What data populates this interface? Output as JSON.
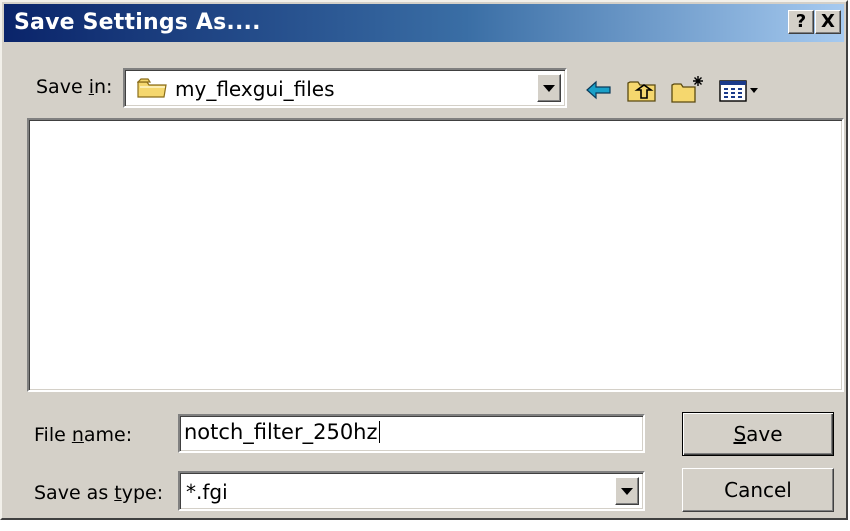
{
  "window": {
    "title": "Save Settings As....",
    "help_label": "?",
    "close_label": "X"
  },
  "save_in": {
    "label_pre": "Save ",
    "label_accel": "i",
    "label_post": "n:",
    "folder": "my_flexgui_files"
  },
  "toolbar": {
    "icons": [
      "back-arrow-icon",
      "up-one-level-icon",
      "create-new-folder-icon",
      "view-menu-icon"
    ]
  },
  "file_name": {
    "label_pre": "File ",
    "label_accel": "n",
    "label_post": "ame:",
    "value": "notch_filter_250hz"
  },
  "save_as_type": {
    "label_pre": "Save as ",
    "label_accel": "t",
    "label_post": "ype:",
    "value": "*.fgi"
  },
  "buttons": {
    "save_accel": "S",
    "save_rest": "ave",
    "cancel": "Cancel"
  },
  "colors": {
    "title_start": "#0a246a",
    "title_end": "#a6caf0",
    "face": "#d4d0c8",
    "folder": "#f5d76e",
    "back_arrow": "#1aa0c8"
  }
}
